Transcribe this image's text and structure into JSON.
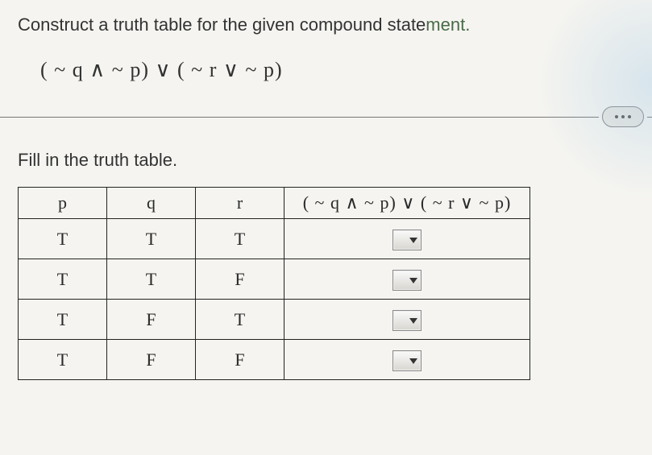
{
  "instruction_prefix": "Construct a truth table for the given compound state",
  "instruction_suffix": "ment.",
  "formula": "( ~ q ∧ ~ p) ∨ ( ~ r ∨ ~ p)",
  "fill_instruction": "Fill in the truth table.",
  "headers": {
    "p": "p",
    "q": "q",
    "r": "r",
    "result": "( ~ q ∧ ~ p) ∨ ( ~ r ∨ ~ p)"
  },
  "rows": [
    {
      "p": "T",
      "q": "T",
      "r": "T"
    },
    {
      "p": "T",
      "q": "T",
      "r": "F"
    },
    {
      "p": "T",
      "q": "F",
      "r": "T"
    },
    {
      "p": "T",
      "q": "F",
      "r": "F"
    }
  ]
}
